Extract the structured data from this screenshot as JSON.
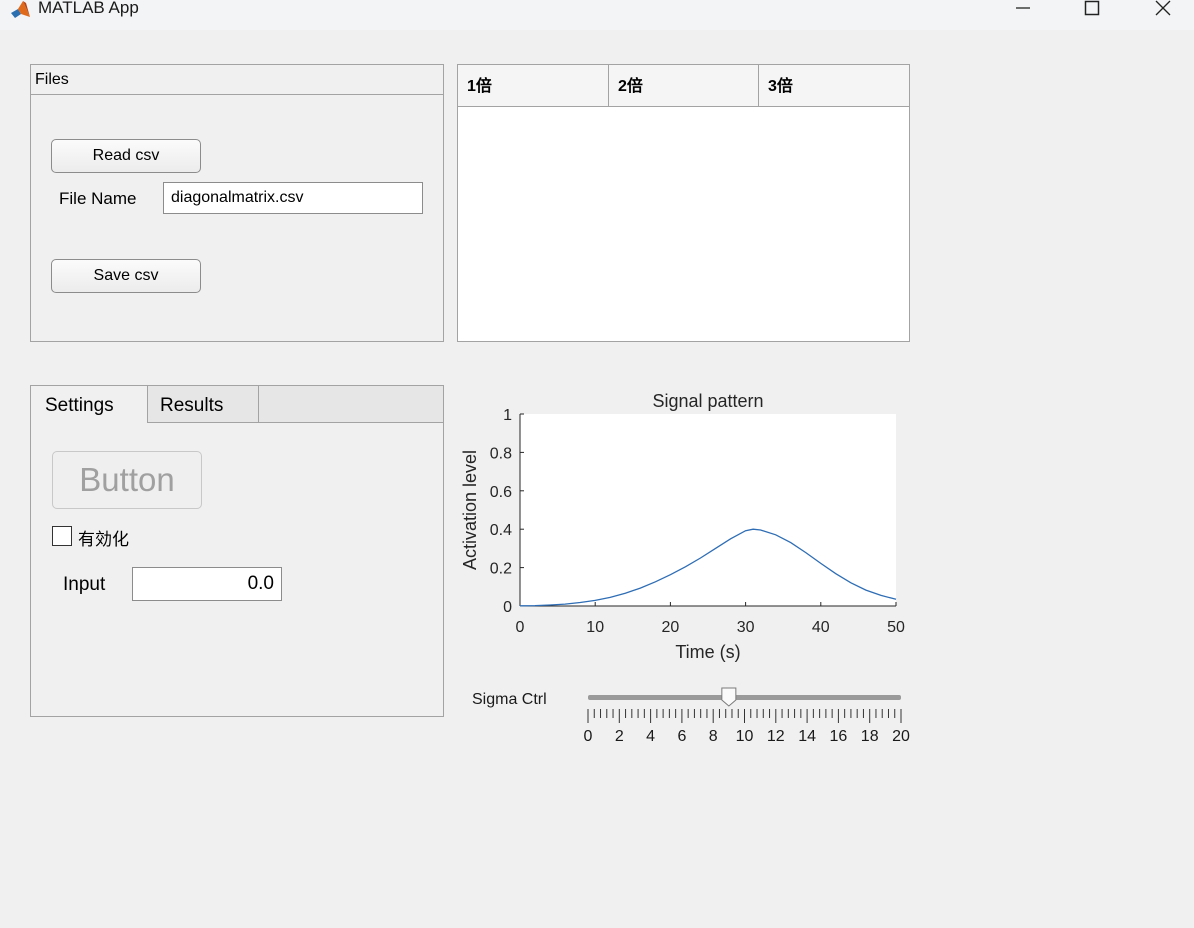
{
  "window": {
    "title": "MATLAB App",
    "controls": [
      "minimize-icon",
      "maximize-icon",
      "close-icon"
    ]
  },
  "files_panel": {
    "title": "Files",
    "read_button": "Read csv",
    "file_name_label": "File Name",
    "file_name_value": "diagonalmatrix.csv",
    "save_button": "Save csv"
  },
  "table": {
    "columns": [
      "1倍",
      "2倍",
      "3倍"
    ],
    "rows": []
  },
  "tabs": {
    "items": [
      {
        "label": "Settings",
        "selected": true
      },
      {
        "label": "Results",
        "selected": false
      }
    ],
    "settings": {
      "button_label": "Button",
      "button_enabled": false,
      "checkbox_label": "有効化",
      "checkbox_checked": false,
      "input_label": "Input",
      "input_value": "0.0"
    }
  },
  "slider": {
    "label": "Sigma Ctrl",
    "min": 0,
    "max": 20,
    "value": 9,
    "tick_labels": [
      "0",
      "2",
      "4",
      "6",
      "8",
      "10",
      "12",
      "14",
      "16",
      "18",
      "20"
    ]
  },
  "colors": {
    "line": "#2e6db5",
    "axes": "#262626",
    "background": "#f0f0f0",
    "panel_border": "#a3a3a3"
  },
  "chart_data": {
    "type": "line",
    "title": "Signal pattern",
    "xlabel": "Time (s)",
    "ylabel": "Activation level",
    "xlim": [
      0,
      50
    ],
    "ylim": [
      0,
      1
    ],
    "xticks": [
      0,
      10,
      20,
      30,
      40,
      50
    ],
    "yticks": [
      0,
      0.2,
      0.4,
      0.6,
      0.8,
      1
    ],
    "grid": false,
    "series": [
      {
        "x": [
          0,
          2,
          4,
          6,
          8,
          10,
          12,
          14,
          16,
          18,
          20,
          22,
          24,
          26,
          28,
          30,
          31,
          32,
          34,
          36,
          38,
          40,
          42,
          44,
          46,
          48,
          50
        ],
        "y": [
          0.001,
          0.002,
          0.005,
          0.01,
          0.018,
          0.029,
          0.045,
          0.066,
          0.093,
          0.126,
          0.163,
          0.204,
          0.25,
          0.3,
          0.35,
          0.392,
          0.4,
          0.396,
          0.371,
          0.33,
          0.278,
          0.222,
          0.168,
          0.121,
          0.083,
          0.055,
          0.035
        ]
      }
    ]
  }
}
